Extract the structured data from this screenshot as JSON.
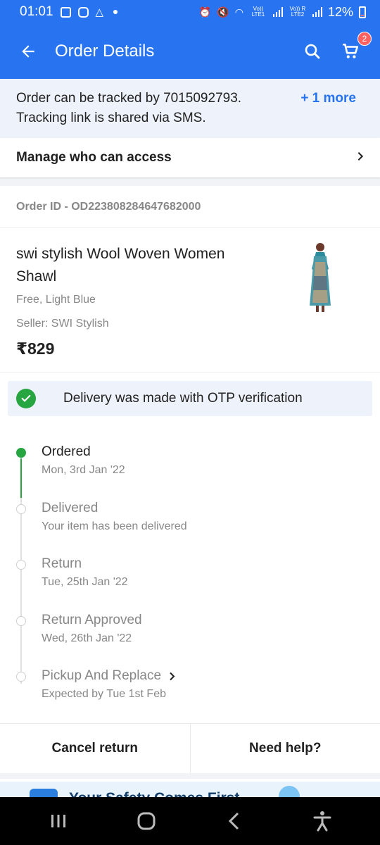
{
  "status_bar": {
    "time": "01:01",
    "net1": "Vo)) LTE1",
    "net2": "Vo)) R LTE2",
    "battery": "12%"
  },
  "header": {
    "title": "Order Details",
    "cart_count": "2"
  },
  "tracking": {
    "message": "Order can be tracked by 7015092793. Tracking link is shared via SMS.",
    "more_label": "+ 1 more"
  },
  "manage_access": {
    "label": "Manage who can access"
  },
  "order": {
    "order_id": "Order ID - OD223808284647682000",
    "product": {
      "name": "swi stylish Wool Woven Women Shawl",
      "variant": "Free, Light Blue",
      "seller": "Seller: SWI Stylish",
      "price": "₹829"
    },
    "otp_message": "Delivery was made with OTP verification",
    "timeline": [
      {
        "title": "Ordered",
        "subtitle": "Mon, 3rd Jan '22"
      },
      {
        "title": "Delivered",
        "subtitle": "Your item has been delivered"
      },
      {
        "title": "Return",
        "subtitle": "Tue, 25th Jan '22"
      },
      {
        "title": "Return Approved",
        "subtitle": "Wed, 26th Jan '22"
      },
      {
        "title": "Pickup And Replace",
        "subtitle": "Expected by Tue 1st Feb"
      }
    ],
    "actions": {
      "cancel_label": "Cancel return",
      "help_label": "Need help?"
    }
  },
  "safety_banner": {
    "title": "Your Safety Comes First"
  },
  "colors": {
    "brand": "#2874f0",
    "success": "#26a541",
    "badge": "#ff6161"
  }
}
